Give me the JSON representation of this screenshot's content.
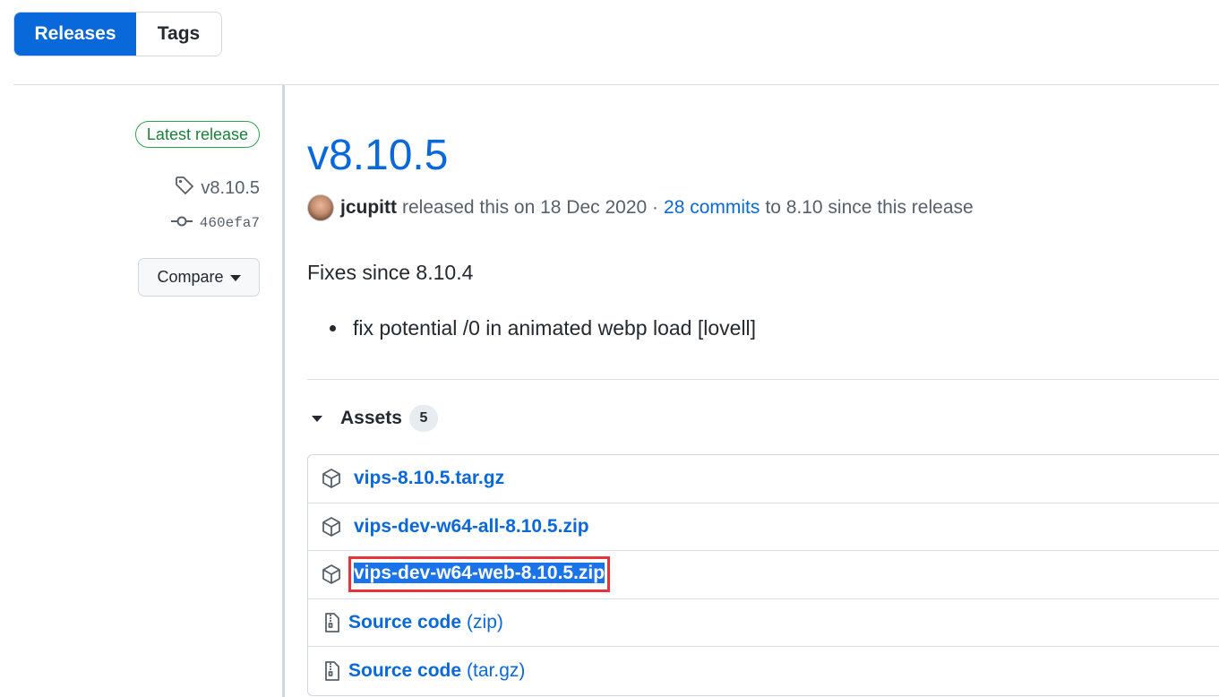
{
  "tabs": [
    {
      "label": "Releases",
      "active": true
    },
    {
      "label": "Tags",
      "active": false
    }
  ],
  "sidebar": {
    "latest_badge": "Latest release",
    "tag": "v8.10.5",
    "commit": "460efa7",
    "compare_label": "Compare"
  },
  "release": {
    "title": "v8.10.5",
    "author": "jcupitt",
    "released_text": "released this on 18 Dec 2020 ·",
    "commits_link": "28 commits",
    "commits_suffix": "to 8.10 since this release",
    "fixes_heading": "Fixes since 8.10.4",
    "fixes": [
      "fix potential /0 in animated webp load [lovell]"
    ]
  },
  "assets": {
    "label": "Assets",
    "count": "5",
    "items": [
      {
        "name": "vips-8.10.5.tar.gz",
        "suffix": "",
        "icon": "package-icon"
      },
      {
        "name": "vips-dev-w64-all-8.10.5.zip",
        "suffix": "",
        "icon": "package-icon"
      },
      {
        "name": "vips-dev-w64-web-8.10.5.zip",
        "suffix": "",
        "icon": "package-icon",
        "selected": true
      },
      {
        "name": "Source code",
        "suffix": "(zip)",
        "icon": "file-zip-icon"
      },
      {
        "name": "Source code",
        "suffix": "(tar.gz)",
        "icon": "file-zip-icon"
      }
    ]
  },
  "colors": {
    "accent": "#0969da",
    "latest_green": "#1a7f37",
    "selection_highlight": "#1a73e8",
    "annotation_red": "#e8323c"
  }
}
